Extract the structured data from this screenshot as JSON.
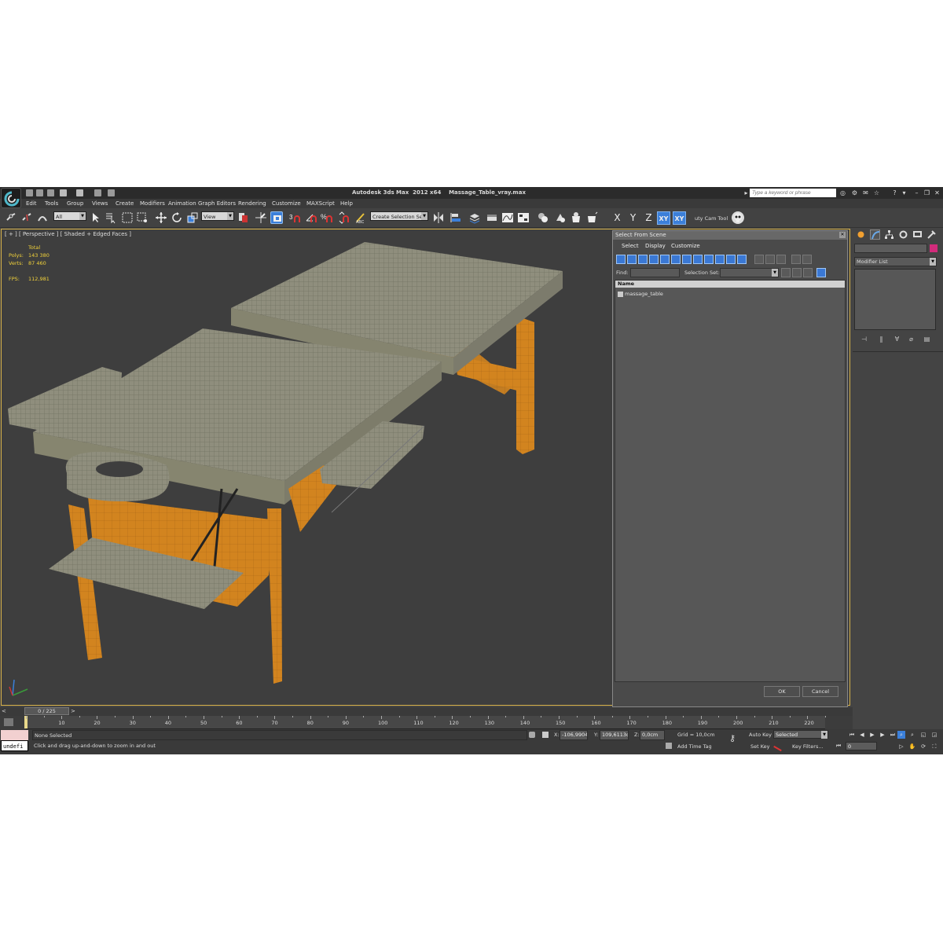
{
  "titlebar": {
    "app_title": "Autodesk 3ds Max  2012 x64",
    "file_name": "Massage_Table_vray.max",
    "search_placeholder": "Type a keyword or phrase"
  },
  "menubar": [
    "Edit",
    "Tools",
    "Group",
    "Views",
    "Create",
    "Modifiers",
    "Animation",
    "Graph Editors",
    "Rendering",
    "Customize",
    "MAXScript",
    "Help"
  ],
  "toolbar": {
    "selection_filter": "All",
    "ref_coord": "View",
    "named_selection": "Create Selection Se",
    "axis_x": "X",
    "axis_y": "Y",
    "axis_z": "Z",
    "axis_xy": "XY",
    "axis_xy2": "XY",
    "plugin_label": "uty Cam Tool"
  },
  "viewport": {
    "label": "[ + ] [ Perspective ] [ Shaded + Edged Faces ]",
    "stats": {
      "total_label": "Total",
      "polys_label": "Polys:",
      "polys_value": "143 380",
      "verts_label": "Verts:",
      "verts_value": "87 460",
      "fps_label": "FPS:",
      "fps_value": "112,981"
    }
  },
  "select_dialog": {
    "title": "Select From Scene",
    "menu": [
      "Select",
      "Display",
      "Customize"
    ],
    "find_label": "Find:",
    "selection_set_label": "Selection Set:",
    "column_name": "Name",
    "objects": [
      "massage_table"
    ],
    "ok_label": "OK",
    "cancel_label": "Cancel"
  },
  "command_panel": {
    "modifier_list": "Modifier List",
    "object_color": "#d22b7b"
  },
  "timeline": {
    "frame_counter": "0 / 225",
    "ticks": [
      "10",
      "20",
      "30",
      "40",
      "50",
      "60",
      "70",
      "80",
      "90",
      "100",
      "110",
      "120",
      "130",
      "140",
      "150",
      "160",
      "170",
      "180",
      "190",
      "200",
      "210",
      "220"
    ]
  },
  "status": {
    "maxscript_output": "undefi",
    "selection": "None Selected",
    "prompt": "Click and drag up-and-down to zoom in and out",
    "x_label": "X:",
    "x_value": "-106,9904",
    "y_label": "Y:",
    "y_value": "109,6113c",
    "z_label": "Z:",
    "z_value": "0,0cm",
    "grid": "Grid = 10,0cm",
    "add_time_tag": "Add Time Tag",
    "auto_key": "Auto Key",
    "set_key": "Set Key",
    "key_mode": "Selected",
    "key_filters": "Key Filters...",
    "current_frame": "0"
  },
  "colors": {
    "selection_accent": "#3b7fd9",
    "viewport_border": "#d8b24a",
    "stats_text": "#f2d23a"
  }
}
